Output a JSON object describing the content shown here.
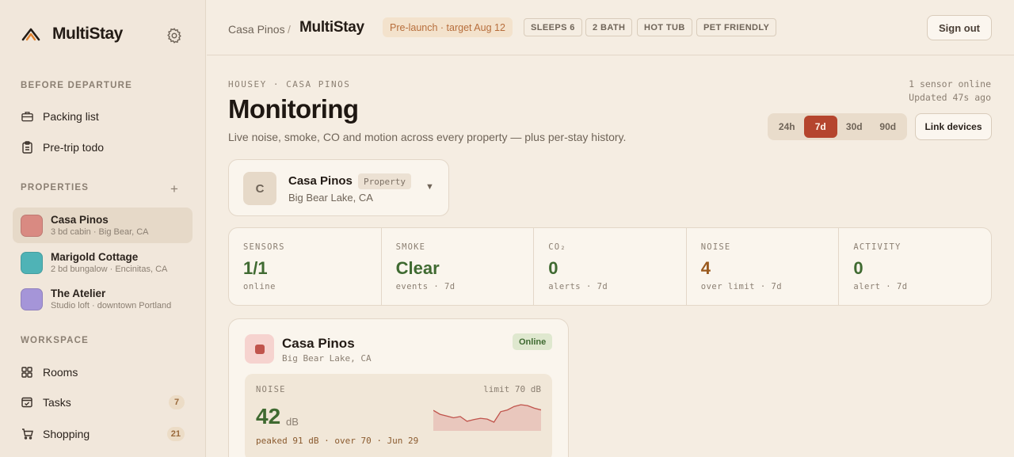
{
  "sidebar": {
    "brand": "MultiStay",
    "sections": {
      "before_departure": "BEFORE DEPARTURE",
      "properties": "PROPERTIES",
      "workspace": "WORKSPACE"
    },
    "before_departure_items": [
      {
        "label": "Packing list",
        "icon": "briefcase-icon"
      },
      {
        "label": "Pre-trip todo",
        "icon": "clipboard-icon"
      }
    ],
    "properties": [
      {
        "name": "Casa Pinos",
        "sub": "3 bd cabin · Big Bear, CA",
        "color": "#d98a82",
        "active": true
      },
      {
        "name": "Marigold Cottage",
        "sub": "2 bd bungalow · Encinitas, CA",
        "color": "#4fb3b6",
        "active": false
      },
      {
        "name": "The Atelier",
        "sub": "Studio loft · downtown Portland",
        "color": "#a595d8",
        "active": false
      }
    ],
    "workspace_items": [
      {
        "label": "Rooms",
        "icon": "grid-icon",
        "count": ""
      },
      {
        "label": "Tasks",
        "icon": "checkbox-icon",
        "count": "7"
      },
      {
        "label": "Shopping",
        "icon": "cart-icon",
        "count": "21"
      }
    ],
    "add_symbol": "+"
  },
  "topbar": {
    "crumb_parent": "Casa Pinos",
    "crumb_sep": "/",
    "crumb_current": "MultiStay",
    "prelaunch": "Pre-launch · target Aug 12",
    "tags": [
      "SLEEPS 6",
      "2 BATH",
      "HOT TUB",
      "PET FRIENDLY"
    ],
    "signout": "Sign out"
  },
  "header": {
    "eyebrow": "HOUSEY · CASA PINOS",
    "title": "Monitoring",
    "subtitle": "Live noise, smoke, CO and motion across every property — plus per-stay history.",
    "sensor_status": "1 sensor online",
    "updated": "Updated 47s ago",
    "ranges": [
      "24h",
      "7d",
      "30d",
      "90d"
    ],
    "active_range": "7d",
    "link_devices": "Link devices"
  },
  "property_select": {
    "initial": "C",
    "name": "Casa Pinos",
    "pill": "Property",
    "location": "Big Bear Lake, CA",
    "caret": "▼"
  },
  "stats": [
    {
      "label": "SENSORS",
      "value": "1/1",
      "sub": "online",
      "color": "#3f6a31"
    },
    {
      "label": "SMOKE",
      "value": "Clear",
      "sub": "events · 7d",
      "color": "#3f6a31"
    },
    {
      "label": "CO₂",
      "value": "0",
      "sub": "alerts · 7d",
      "color": "#3f6a31"
    },
    {
      "label": "NOISE",
      "value": "4",
      "sub": "over limit · 7d",
      "color": "#9a5a1e"
    },
    {
      "label": "ACTIVITY",
      "value": "0",
      "sub": "alert · 7d",
      "color": "#3f6a31"
    }
  ],
  "device": {
    "name": "Casa Pinos",
    "location": "Big Bear Lake, CA",
    "status": "Online",
    "noise_label": "NOISE",
    "limit": "limit 70 dB",
    "value": "42",
    "unit": "dB",
    "peak": "peaked 91 dB · over 70 · Jun 29",
    "sparkline": [
      71,
      62,
      58,
      54,
      57,
      46,
      50,
      53,
      51,
      44,
      68,
      72,
      80,
      84,
      82,
      76,
      72
    ]
  },
  "colors": {
    "accent": "#b5452e",
    "good": "#3f6a31",
    "warn": "#9a5a1e",
    "spark_line": "#c0544c",
    "spark_fill": "#e9c7bd"
  }
}
